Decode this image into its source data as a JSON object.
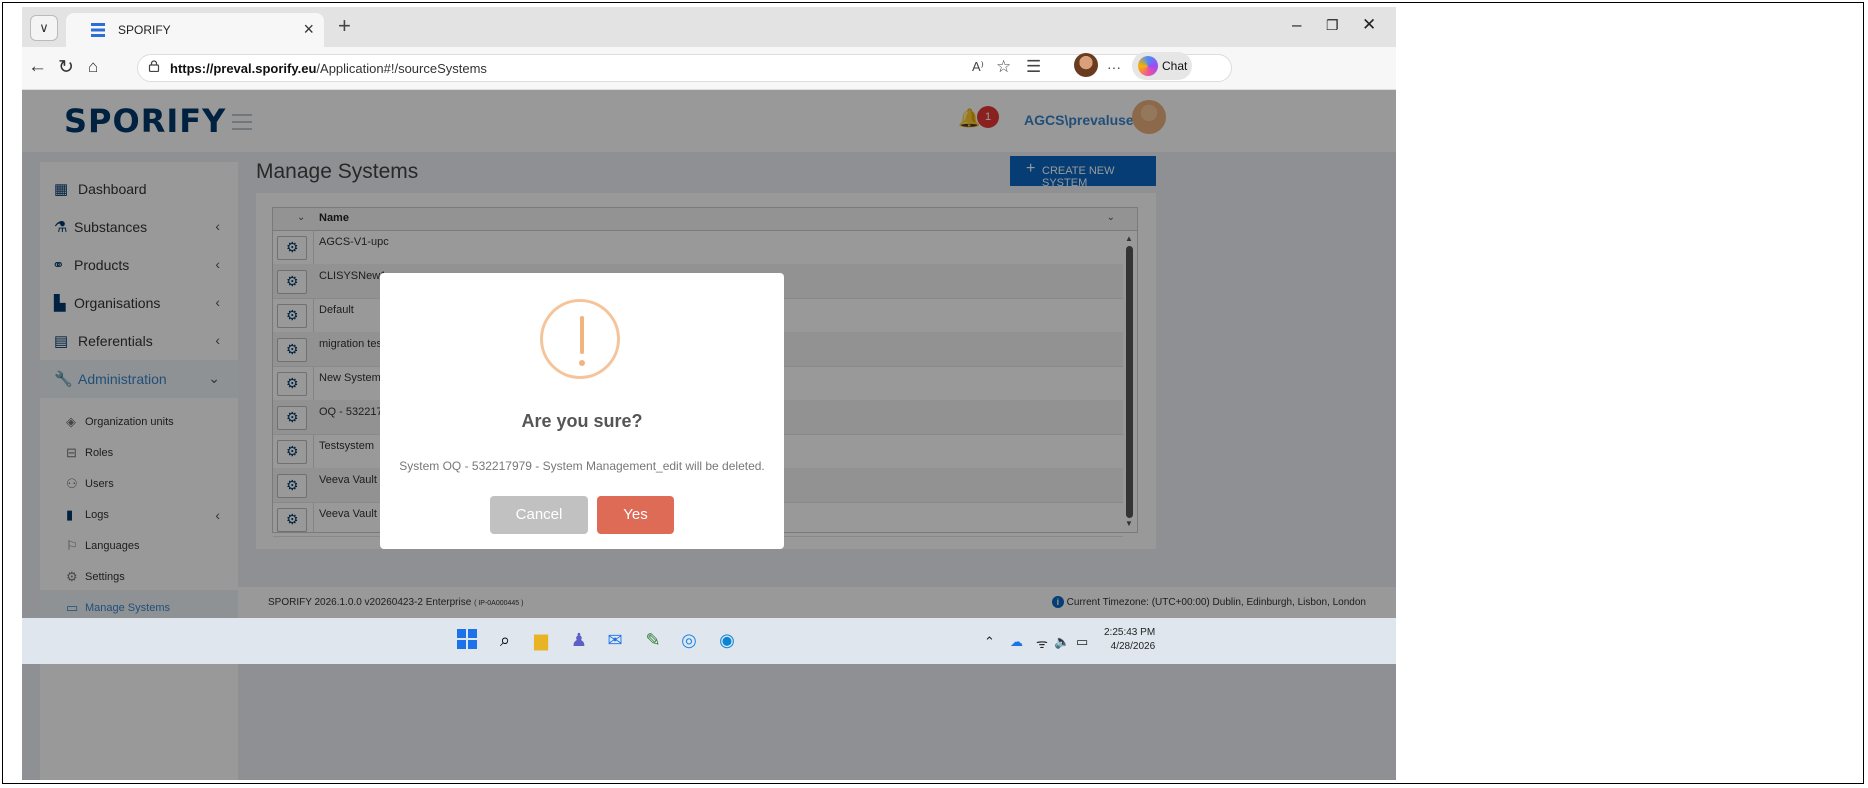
{
  "browser": {
    "tab_title": "SPORIFY",
    "tab_close": "×",
    "new_tab": "+",
    "url_host": "https://preval.sporify.eu",
    "url_path": "/Application#!/sourceSystems",
    "chat_label": "Chat",
    "read_aloud": "A⁾",
    "more": "···"
  },
  "app": {
    "logo": "SPORIFY",
    "notification_count": "1",
    "username": "AGCS\\prevaluser2"
  },
  "sidebar": {
    "items": [
      {
        "label": "Dashboard"
      },
      {
        "label": "Substances"
      },
      {
        "label": "Products"
      },
      {
        "label": "Organisations"
      },
      {
        "label": "Referentials"
      },
      {
        "label": "Administration"
      }
    ],
    "sub_items": [
      {
        "label": "Organization units"
      },
      {
        "label": "Roles"
      },
      {
        "label": "Users"
      },
      {
        "label": "Logs"
      },
      {
        "label": "Languages"
      },
      {
        "label": "Settings"
      },
      {
        "label": "Manage Systems"
      }
    ]
  },
  "main": {
    "title": "Manage Systems",
    "create_button": "CREATE NEW SYSTEM",
    "grid": {
      "column": "Name",
      "rows": [
        "AGCS-V1-upc",
        "CLISYSNew1",
        "Default",
        "migration tes",
        "New System1",
        "OQ - 532217",
        "Testsystem",
        "Veeva Vault",
        "Veeva Vault"
      ]
    }
  },
  "footer": {
    "version": "SPORIFY 2026.1.0.0 v20260423-2 Enterprise",
    "ip": "( IP-0A000445 )",
    "timezone": "Current Timezone: (UTC+00:00) Dublin, Edinburgh, Lisbon, London"
  },
  "dialog": {
    "title": "Are you sure?",
    "message": "System OQ - 532217979 - System Management_edit will be deleted.",
    "cancel_label": "Cancel",
    "confirm_label": "Yes"
  },
  "taskbar": {
    "time": "2:25:43 PM",
    "date": "4/28/2026"
  },
  "colors": {
    "brand": "#00386b",
    "accent": "#0a66c2",
    "confirm": "#dd6b55",
    "cancel": "#c1c1c1"
  }
}
